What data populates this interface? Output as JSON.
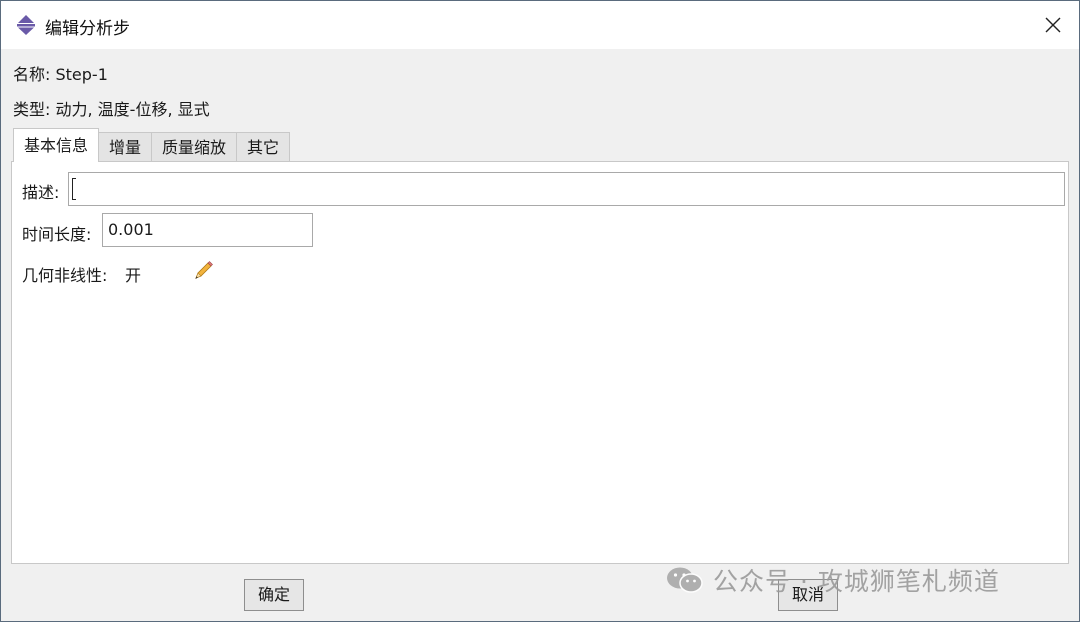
{
  "window": {
    "title": "编辑分析步",
    "close_icon": "close-icon"
  },
  "info": {
    "name_label": "名称:",
    "name_value": "Step-1",
    "type_label": "类型:",
    "type_value": "动力, 温度-位移, 显式"
  },
  "tabs": [
    {
      "label": "基本信息",
      "active": true
    },
    {
      "label": "增量",
      "active": false
    },
    {
      "label": "质量缩放",
      "active": false
    },
    {
      "label": "其它",
      "active": false
    }
  ],
  "form": {
    "description_label": "描述:",
    "description_value": "",
    "time_period_label": "时间长度:",
    "time_period_value": "0.001",
    "nlgeom_label": "几何非线性:",
    "nlgeom_value": "开",
    "edit_icon": "pencil-icon"
  },
  "buttons": {
    "ok_label": "确定",
    "cancel_label": "取消"
  },
  "watermark": {
    "text": "公众号 · 攻城狮笔札频道",
    "icon": "wechat-icon"
  },
  "colors": {
    "title_background": "#ffffff",
    "window_background": "#f0f0f0",
    "panel_background": "#ffffff",
    "icon_accent": "#6a5aa8"
  }
}
